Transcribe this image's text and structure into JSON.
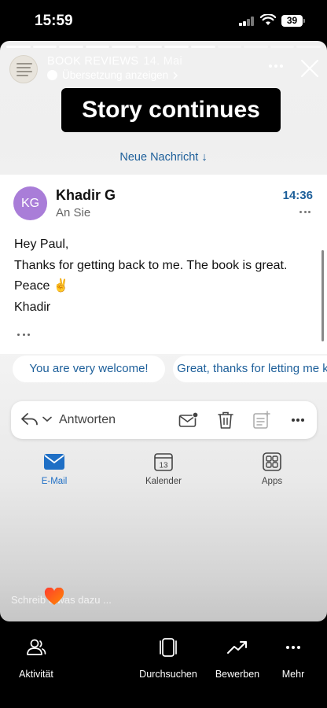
{
  "status_bar": {
    "time": "15:59",
    "battery": "39",
    "icons": [
      "cellular-signal-icon",
      "wifi-icon",
      "battery-icon"
    ]
  },
  "story": {
    "account_name": "BOOK REVIEWS",
    "date": "14. Mai",
    "translate_label": "Übersetzung anzeigen",
    "overlay_text": "Story continues",
    "comment_placeholder": "Schreib etwas dazu ..."
  },
  "email": {
    "new_message_label": "Neue Nachricht ↓",
    "avatar_initials": "KG",
    "sender": "Khadir G",
    "recipient": "An Sie",
    "time": "14:36",
    "body": [
      "Hey Paul,",
      "Thanks for getting back to me. The book is great.",
      "Peace ✌️",
      "Khadir"
    ],
    "quick_replies": [
      "You are very welcome!",
      "Great, thanks for letting me know"
    ],
    "reply_label": "Antworten"
  },
  "outlook_tabs": [
    {
      "label": "E-Mail",
      "icon": "mail-icon",
      "active": true
    },
    {
      "label": "Kalender",
      "icon": "calendar-icon",
      "day": "13",
      "active": false
    },
    {
      "label": "Apps",
      "icon": "apps-grid-icon",
      "active": false
    }
  ],
  "bottom_bar": {
    "items": [
      {
        "label": "Aktivität",
        "icon": "activity-people-icon"
      },
      {
        "label": "Durchsuchen",
        "icon": "browse-cards-icon"
      },
      {
        "label": "Bewerben",
        "icon": "trending-up-icon"
      },
      {
        "label": "Mehr",
        "icon": "more-dots-icon"
      }
    ]
  },
  "colors": {
    "accent_blue": "#1d5f9a",
    "outlook_blue": "#1f6fc5",
    "avatar_purple": "#a97dd8",
    "black": "#000000"
  }
}
